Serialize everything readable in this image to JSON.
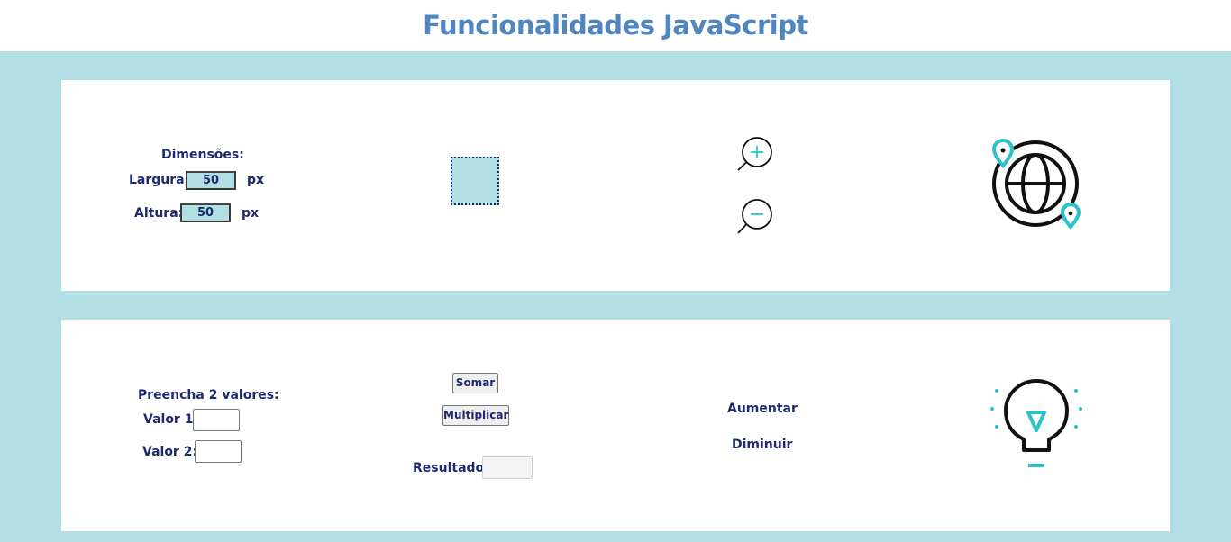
{
  "header": {
    "title": "Funcionalidades JavaScript"
  },
  "dimensions": {
    "heading": "Dimensões:",
    "width_label": "Largura:",
    "width_value": "50",
    "height_label": "Altura:",
    "height_value": "50",
    "unit": "px"
  },
  "zoom": {
    "zoom_in_icon": "zoom-in-icon",
    "zoom_out_icon": "zoom-out-icon"
  },
  "globe": {
    "icon": "globe-location-icon"
  },
  "calculator": {
    "heading": "Preencha 2 valores:",
    "value1_label": "Valor 1:",
    "value2_label": "Valor 2:",
    "value1": "",
    "value2": "",
    "sum_button": "Somar",
    "multiply_button": "Multiplicar",
    "result_label": "Resultado:",
    "result_value": ""
  },
  "text_size": {
    "increase": "Aumentar",
    "decrease": "Diminuir"
  },
  "bulb": {
    "icon": "lightbulb-icon"
  },
  "colors": {
    "accent": "#4f86bf",
    "band": "#b2dfe4",
    "text": "#1e2a6e",
    "icon_teal": "#2bc3c8"
  }
}
